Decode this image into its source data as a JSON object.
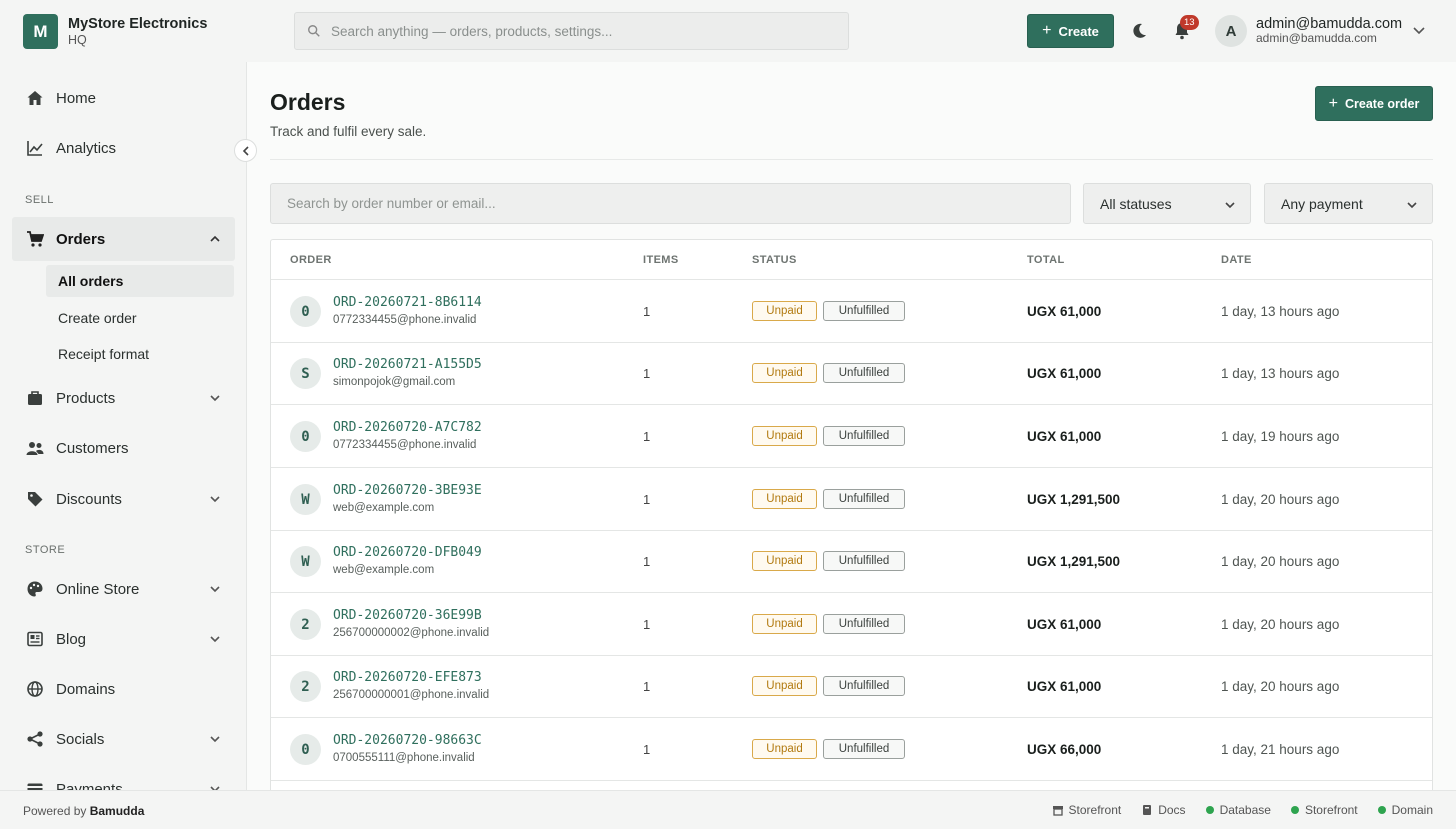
{
  "brand": {
    "logo_letter": "M",
    "name": "MyStore Electronics",
    "sub": "HQ"
  },
  "search": {
    "placeholder": "Search anything — orders, products, settings..."
  },
  "topbar": {
    "create_label": "Create",
    "notifications_count": "13",
    "user_initial": "A",
    "user_name": "admin@bamudda.com",
    "user_email": "admin@bamudda.com"
  },
  "sidebar": {
    "home": "Home",
    "analytics": "Analytics",
    "section_sell": "SELL",
    "orders": "Orders",
    "orders_sub": [
      "All orders",
      "Create order",
      "Receipt format"
    ],
    "products": "Products",
    "customers": "Customers",
    "discounts": "Discounts",
    "section_store": "STORE",
    "online_store": "Online Store",
    "blog": "Blog",
    "domains": "Domains",
    "socials": "Socials",
    "payments": "Payments"
  },
  "page": {
    "title": "Orders",
    "subtitle": "Track and fulfil every sale.",
    "create_order_label": "Create order",
    "filter_placeholder": "Search by order number or email...",
    "status_select": "All statuses",
    "payment_select": "Any payment"
  },
  "table": {
    "headers": {
      "order": "ORDER",
      "items": "ITEMS",
      "status": "STATUS",
      "total": "TOTAL",
      "date": "DATE"
    },
    "rows": [
      {
        "initial": "0",
        "order_no": "ORD-20260721-8B6114",
        "email": "0772334455@phone.invalid",
        "items": "1",
        "payment": "Unpaid",
        "fulfillment": "Unfulfilled",
        "total": "UGX 61,000",
        "date": "1 day, 13 hours ago"
      },
      {
        "initial": "S",
        "order_no": "ORD-20260721-A155D5",
        "email": "simonpojok@gmail.com",
        "items": "1",
        "payment": "Unpaid",
        "fulfillment": "Unfulfilled",
        "total": "UGX 61,000",
        "date": "1 day, 13 hours ago"
      },
      {
        "initial": "0",
        "order_no": "ORD-20260720-A7C782",
        "email": "0772334455@phone.invalid",
        "items": "1",
        "payment": "Unpaid",
        "fulfillment": "Unfulfilled",
        "total": "UGX 61,000",
        "date": "1 day, 19 hours ago"
      },
      {
        "initial": "W",
        "order_no": "ORD-20260720-3BE93E",
        "email": "web@example.com",
        "items": "1",
        "payment": "Unpaid",
        "fulfillment": "Unfulfilled",
        "total": "UGX 1,291,500",
        "date": "1 day, 20 hours ago"
      },
      {
        "initial": "W",
        "order_no": "ORD-20260720-DFB049",
        "email": "web@example.com",
        "items": "1",
        "payment": "Unpaid",
        "fulfillment": "Unfulfilled",
        "total": "UGX 1,291,500",
        "date": "1 day, 20 hours ago"
      },
      {
        "initial": "2",
        "order_no": "ORD-20260720-36E99B",
        "email": "256700000002@phone.invalid",
        "items": "1",
        "payment": "Unpaid",
        "fulfillment": "Unfulfilled",
        "total": "UGX 61,000",
        "date": "1 day, 20 hours ago"
      },
      {
        "initial": "2",
        "order_no": "ORD-20260720-EFE873",
        "email": "256700000001@phone.invalid",
        "items": "1",
        "payment": "Unpaid",
        "fulfillment": "Unfulfilled",
        "total": "UGX 61,000",
        "date": "1 day, 20 hours ago"
      },
      {
        "initial": "0",
        "order_no": "ORD-20260720-98663C",
        "email": "0700555111@phone.invalid",
        "items": "1",
        "payment": "Unpaid",
        "fulfillment": "Unfulfilled",
        "total": "UGX 66,000",
        "date": "1 day, 21 hours ago"
      }
    ]
  },
  "footer": {
    "powered_prefix": "Powered by",
    "powered_brand": "Bamudda",
    "links": {
      "storefront": "Storefront",
      "docs": "Docs"
    },
    "status": {
      "database": "Database",
      "storefront": "Storefront",
      "domain": "Domain"
    }
  },
  "colors": {
    "accent": "#2f6f5d",
    "unpaid": "#b27a10",
    "status_ok": "#2ea44f",
    "badge": "#c0392b"
  }
}
